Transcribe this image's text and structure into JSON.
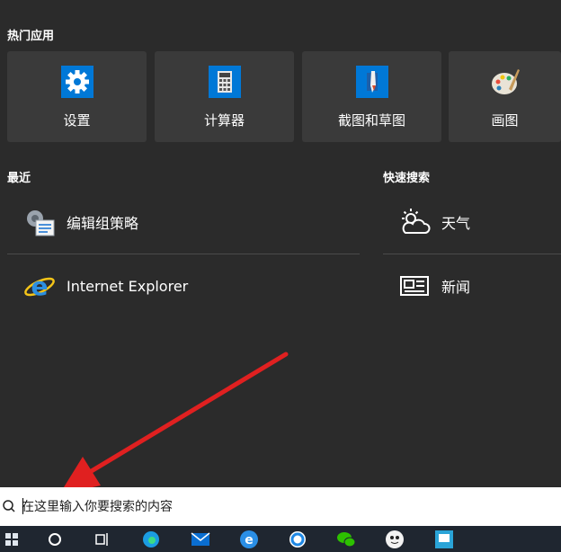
{
  "popular": {
    "title": "热门应用",
    "apps": [
      {
        "label": "设置",
        "icon": "settings-gear-icon"
      },
      {
        "label": "计算器",
        "icon": "calculator-icon"
      },
      {
        "label": "截图和草图",
        "icon": "snip-sketch-icon"
      },
      {
        "label": "画图",
        "icon": "paint-palette-icon"
      }
    ]
  },
  "recent": {
    "title": "最近",
    "items": [
      {
        "label": "编辑组策略",
        "icon": "group-policy-icon"
      },
      {
        "label": "Internet Explorer",
        "icon": "internet-explorer-icon"
      }
    ]
  },
  "quick_search": {
    "title": "快速搜索",
    "items": [
      {
        "label": "天气",
        "icon": "weather-icon"
      },
      {
        "label": "新闻",
        "icon": "news-icon"
      }
    ]
  },
  "search": {
    "placeholder": "在这里输入你要搜索的内容"
  },
  "taskbar": {
    "items": [
      "start-icon",
      "cortana-icon",
      "task-view-icon",
      "edge-icon",
      "mail-icon",
      "browser-icon",
      "qq-browser-icon",
      "wechat-icon",
      "game-icon",
      "app-icon"
    ]
  },
  "colors": {
    "background": "#2b2b2b",
    "tile": "#3a3a3a",
    "accent_blue": "#0078d7",
    "annotation_arrow": "#e02020"
  }
}
